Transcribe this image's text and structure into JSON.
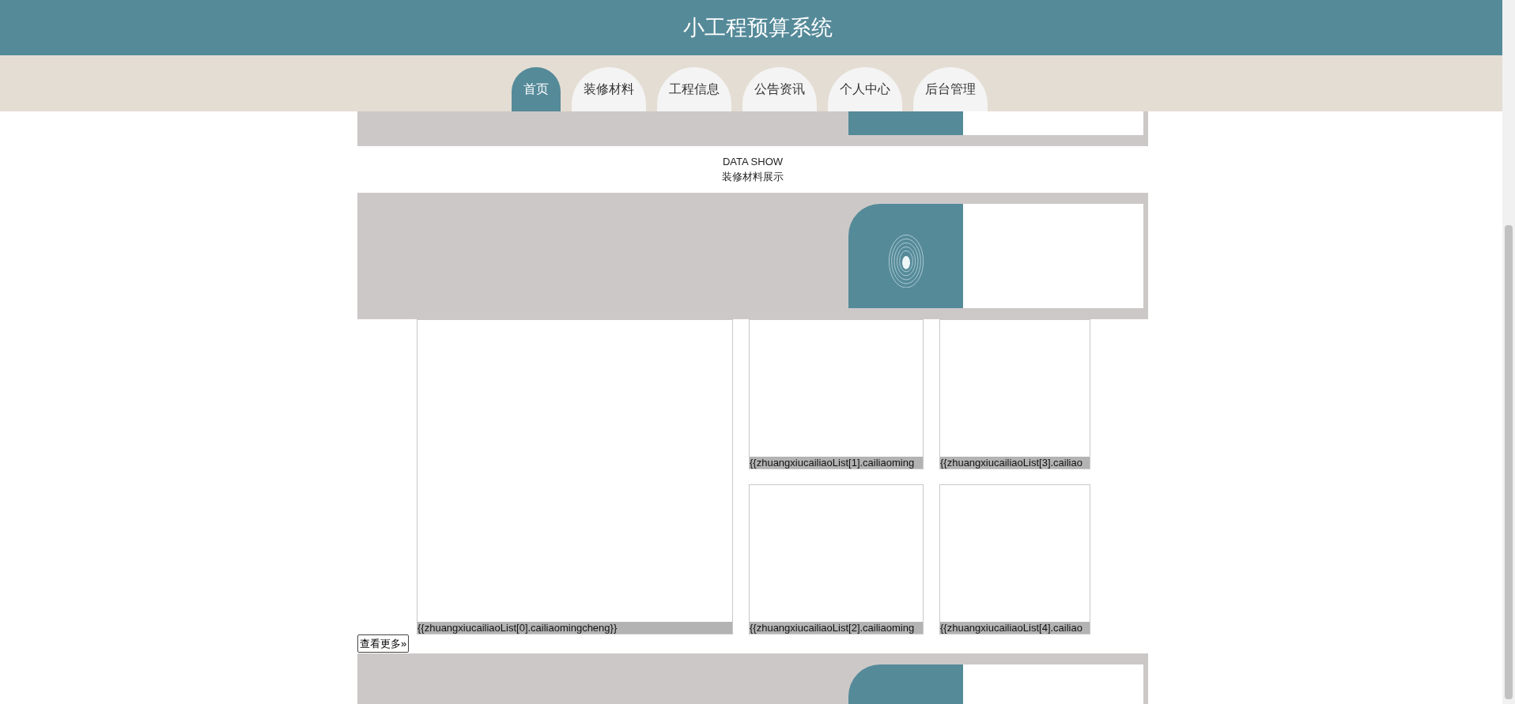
{
  "header": {
    "title": "小工程预算系统"
  },
  "nav": [
    {
      "label": "首页",
      "selected": true
    },
    {
      "label": "装修材料",
      "selected": false
    },
    {
      "label": "工程信息",
      "selected": false
    },
    {
      "label": "公告资讯",
      "selected": false
    },
    {
      "label": "个人中心",
      "selected": false
    },
    {
      "label": "后台管理",
      "selected": false
    }
  ],
  "section": {
    "subtitle": "DATA SHOW",
    "title": "装修材料展示"
  },
  "products": [
    {
      "caption": "{{zhuangxiucailiaoList[0].cailiaomingcheng}}"
    },
    {
      "caption": "{{zhuangxiucailiaoList[1].cailiaoming"
    },
    {
      "caption": "{{zhuangxiucailiaoList[2].cailiaoming"
    },
    {
      "caption": "{{zhuangxiucailiaoList[3].cailiao"
    },
    {
      "caption": "{{zhuangxiucailiaoList[4].cailiao"
    }
  ],
  "more_button": "查看更多»"
}
